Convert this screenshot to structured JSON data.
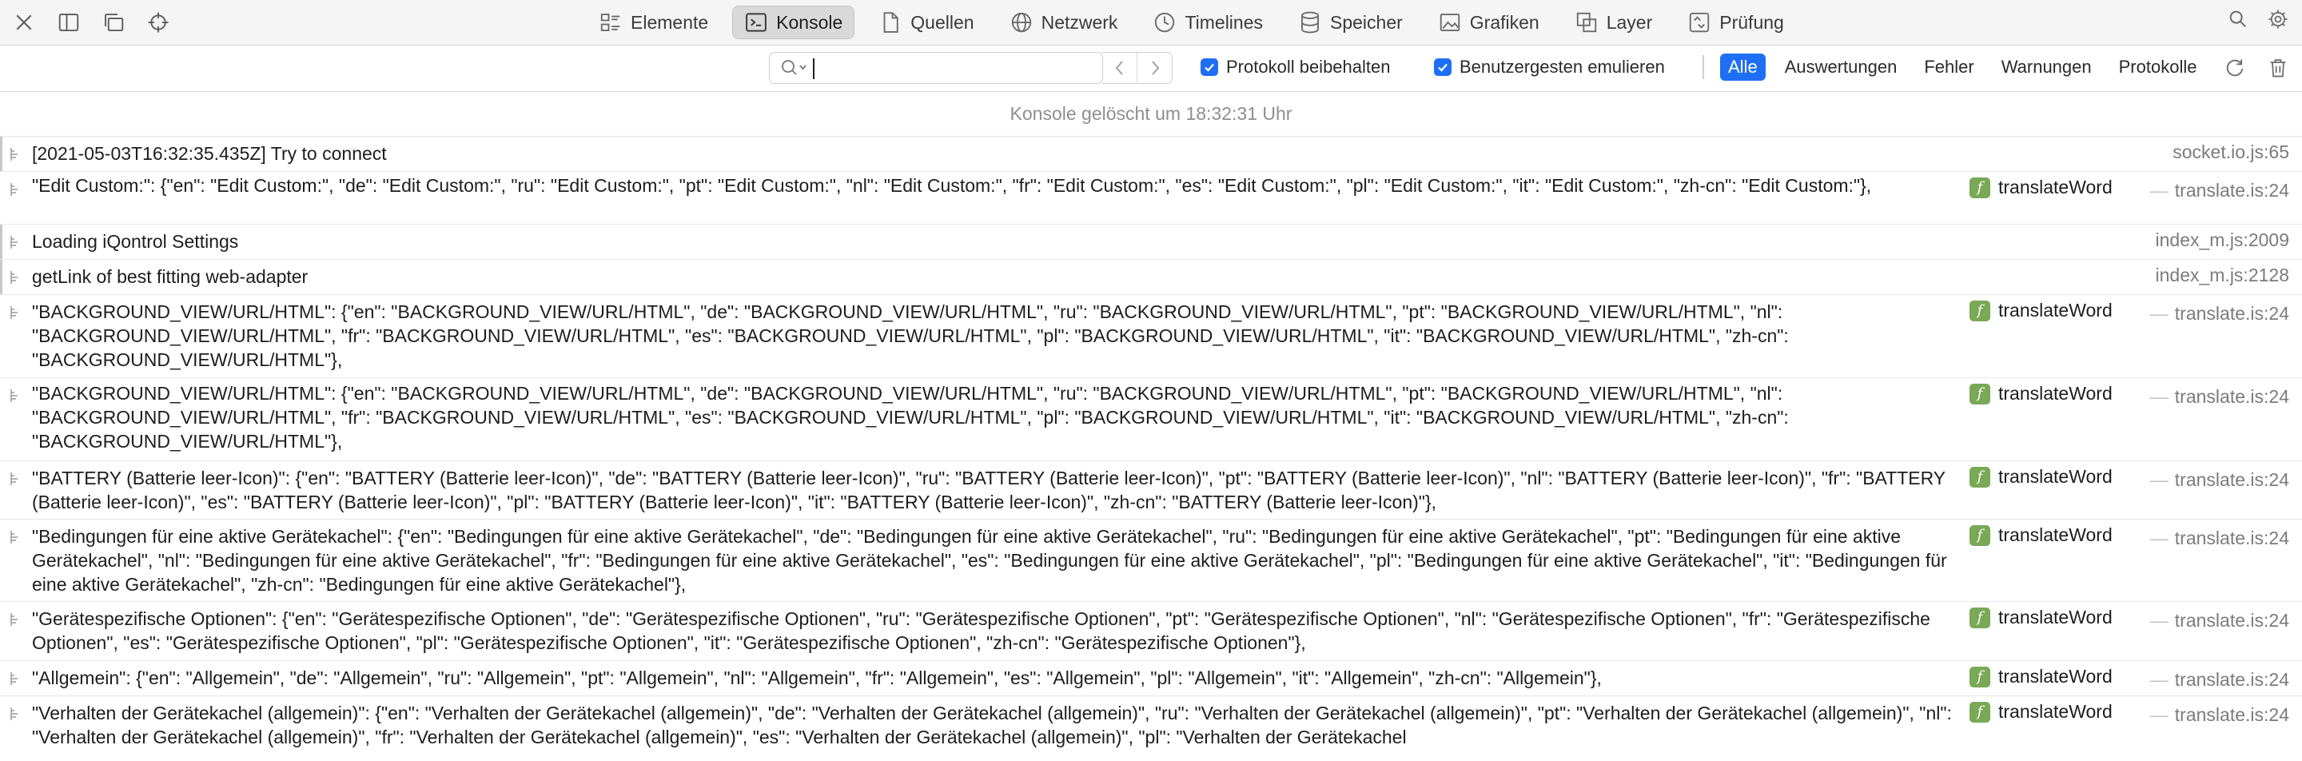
{
  "toolbar": {
    "tabs": [
      {
        "label": "Elemente",
        "icon": "elements-icon"
      },
      {
        "label": "Konsole",
        "icon": "console-icon",
        "active": true
      },
      {
        "label": "Quellen",
        "icon": "sources-icon"
      },
      {
        "label": "Netzwerk",
        "icon": "network-icon"
      },
      {
        "label": "Timelines",
        "icon": "timelines-icon"
      },
      {
        "label": "Speicher",
        "icon": "storage-icon"
      },
      {
        "label": "Grafiken",
        "icon": "graphics-icon"
      },
      {
        "label": "Layer",
        "icon": "layers-icon"
      },
      {
        "label": "Prüfung",
        "icon": "audit-icon"
      }
    ]
  },
  "filterbar": {
    "search_value": "",
    "preserve_log_label": "Protokoll beibehalten",
    "emulate_gesture_label": "Benutzergesten emulieren",
    "levels": [
      "Alle",
      "Auswertungen",
      "Fehler",
      "Warnungen",
      "Protokolle"
    ],
    "active_level": "Alle"
  },
  "console": {
    "cleared_text": "Konsole gelöscht um 18:32:31 Uhr",
    "messages": [
      {
        "text": "[2021-05-03T16:32:35.435Z] Try to connect",
        "fn": "",
        "source": "socket.io.js:65"
      },
      {
        "text": "\"Edit Custom:\": {\"en\": \"Edit Custom:\", \"de\": \"Edit Custom:\", \"ru\": \"Edit Custom:\", \"pt\": \"Edit Custom:\", \"nl\": \"Edit Custom:\", \"fr\": \"Edit Custom:\", \"es\": \"Edit Custom:\", \"pl\": \"Edit Custom:\", \"it\": \"Edit Custom:\", \"zh-cn\": \"Edit Custom:\"},",
        "fn": "translateWord",
        "source": "translate.is:24"
      },
      {
        "text": "Loading iQontrol Settings",
        "fn": "",
        "source": "index_m.js:2009"
      },
      {
        "text": "getLink of best fitting web-adapter",
        "fn": "",
        "source": "index_m.js:2128"
      },
      {
        "text": "\"BACKGROUND_VIEW/URL/HTML\": {\"en\": \"BACKGROUND_VIEW/URL/HTML\", \"de\": \"BACKGROUND_VIEW/URL/HTML\", \"ru\": \"BACKGROUND_VIEW/URL/HTML\", \"pt\": \"BACKGROUND_VIEW/URL/HTML\", \"nl\": \"BACKGROUND_VIEW/URL/HTML\", \"fr\": \"BACKGROUND_VIEW/URL/HTML\", \"es\": \"BACKGROUND_VIEW/URL/HTML\", \"pl\": \"BACKGROUND_VIEW/URL/HTML\", \"it\": \"BACKGROUND_VIEW/URL/HTML\", \"zh-cn\": \"BACKGROUND_VIEW/URL/HTML\"},",
        "fn": "translateWord",
        "source": "translate.is:24"
      },
      {
        "text": "\"BACKGROUND_VIEW/URL/HTML\": {\"en\": \"BACKGROUND_VIEW/URL/HTML\", \"de\": \"BACKGROUND_VIEW/URL/HTML\", \"ru\": \"BACKGROUND_VIEW/URL/HTML\", \"pt\": \"BACKGROUND_VIEW/URL/HTML\", \"nl\": \"BACKGROUND_VIEW/URL/HTML\", \"fr\": \"BACKGROUND_VIEW/URL/HTML\", \"es\": \"BACKGROUND_VIEW/URL/HTML\", \"pl\": \"BACKGROUND_VIEW/URL/HTML\", \"it\": \"BACKGROUND_VIEW/URL/HTML\", \"zh-cn\": \"BACKGROUND_VIEW/URL/HTML\"},",
        "fn": "translateWord",
        "source": "translate.is:24"
      },
      {
        "text": "\"BATTERY (Batterie leer-Icon)\": {\"en\": \"BATTERY (Batterie leer-Icon)\", \"de\": \"BATTERY (Batterie leer-Icon)\", \"ru\": \"BATTERY (Batterie leer-Icon)\", \"pt\": \"BATTERY (Batterie leer-Icon)\", \"nl\": \"BATTERY (Batterie leer-Icon)\", \"fr\": \"BATTERY (Batterie leer-Icon)\", \"es\": \"BATTERY (Batterie leer-Icon)\", \"pl\": \"BATTERY (Batterie leer-Icon)\", \"it\": \"BATTERY (Batterie leer-Icon)\", \"zh-cn\": \"BATTERY (Batterie leer-Icon)\"},",
        "fn": "translateWord",
        "source": "translate.is:24"
      },
      {
        "text": "\"Bedingungen für eine aktive Gerätekachel\": {\"en\": \"Bedingungen für eine aktive Gerätekachel\", \"de\": \"Bedingungen für eine aktive Gerätekachel\", \"ru\": \"Bedingungen für eine aktive Gerätekachel\", \"pt\": \"Bedingungen für eine aktive Gerätekachel\", \"nl\": \"Bedingungen für eine aktive Gerätekachel\", \"fr\": \"Bedingungen für eine aktive Gerätekachel\", \"es\": \"Bedingungen für eine aktive Gerätekachel\", \"pl\": \"Bedingungen für eine aktive Gerätekachel\", \"it\": \"Bedingungen für eine aktive Gerätekachel\", \"zh-cn\": \"Bedingungen für eine aktive Gerätekachel\"},",
        "fn": "translateWord",
        "source": "translate.is:24"
      },
      {
        "text": "\"Gerätespezifische Optionen\": {\"en\": \"Gerätespezifische Optionen\", \"de\": \"Gerätespezifische Optionen\", \"ru\": \"Gerätespezifische Optionen\", \"pt\": \"Gerätespezifische Optionen\", \"nl\": \"Gerätespezifische Optionen\", \"fr\": \"Gerätespezifische Optionen\", \"es\": \"Gerätespezifische Optionen\", \"pl\": \"Gerätespezifische Optionen\", \"it\": \"Gerätespezifische Optionen\", \"zh-cn\": \"Gerätespezifische Optionen\"},",
        "fn": "translateWord",
        "source": "translate.is:24"
      },
      {
        "text": "\"Allgemein\": {\"en\": \"Allgemein\", \"de\": \"Allgemein\", \"ru\": \"Allgemein\", \"pt\": \"Allgemein\", \"nl\": \"Allgemein\", \"fr\": \"Allgemein\", \"es\": \"Allgemein\", \"pl\": \"Allgemein\", \"it\": \"Allgemein\", \"zh-cn\": \"Allgemein\"},",
        "fn": "translateWord",
        "source": "translate.is:24"
      },
      {
        "text": "\"Verhalten der Gerätekachel (allgemein)\": {\"en\": \"Verhalten der Gerätekachel (allgemein)\", \"de\": \"Verhalten der Gerätekachel (allgemein)\", \"ru\": \"Verhalten der Gerätekachel (allgemein)\", \"pt\": \"Verhalten der Gerätekachel (allgemein)\", \"nl\": \"Verhalten der Gerätekachel (allgemein)\", \"fr\": \"Verhalten der Gerätekachel (allgemein)\", \"es\": \"Verhalten der Gerätekachel (allgemein)\", \"pl\": \"Verhalten der Gerätekachel",
        "fn": "translateWord",
        "source": "translate.is:24"
      }
    ]
  }
}
